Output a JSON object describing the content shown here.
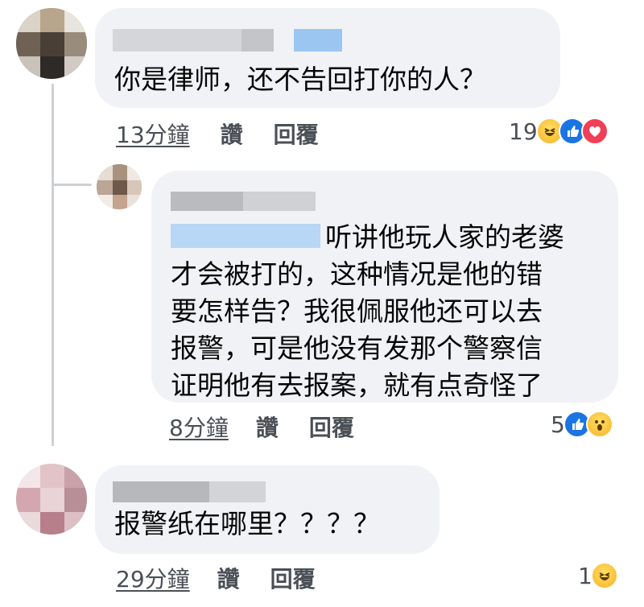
{
  "comments": [
    {
      "text_lines": [
        "你是律师，还不告回打你的人？"
      ],
      "time": "13分鐘",
      "like_label": "讚",
      "reply_label": "回覆",
      "reaction_count": "19",
      "reactions": [
        "haha-icon",
        "like-icon",
        "love-icon"
      ]
    },
    {
      "text_lines": [
        "听讲他玩人家的老婆",
        "才会被打的，这种情况是他的错",
        "要怎样告？我很佩服他还可以去",
        "报警，可是他没有发那个警察信",
        "证明他有去报案，就有点奇怪了"
      ],
      "time": "8分鐘",
      "like_label": "讚",
      "reply_label": "回覆",
      "reaction_count": "5",
      "reactions": [
        "like-icon",
        "wow-icon"
      ]
    },
    {
      "text_lines": [
        "报警纸在哪里？？？？"
      ],
      "time": "29分鐘",
      "like_label": "讚",
      "reply_label": "回覆",
      "reaction_count": "1",
      "reactions": [
        "haha-icon"
      ]
    }
  ],
  "colors": {
    "bubble": "#f0f2f5",
    "meta": "#4b4f56",
    "like": "#1b74e4",
    "love": "#f33e58",
    "haha": "#f7b125"
  }
}
